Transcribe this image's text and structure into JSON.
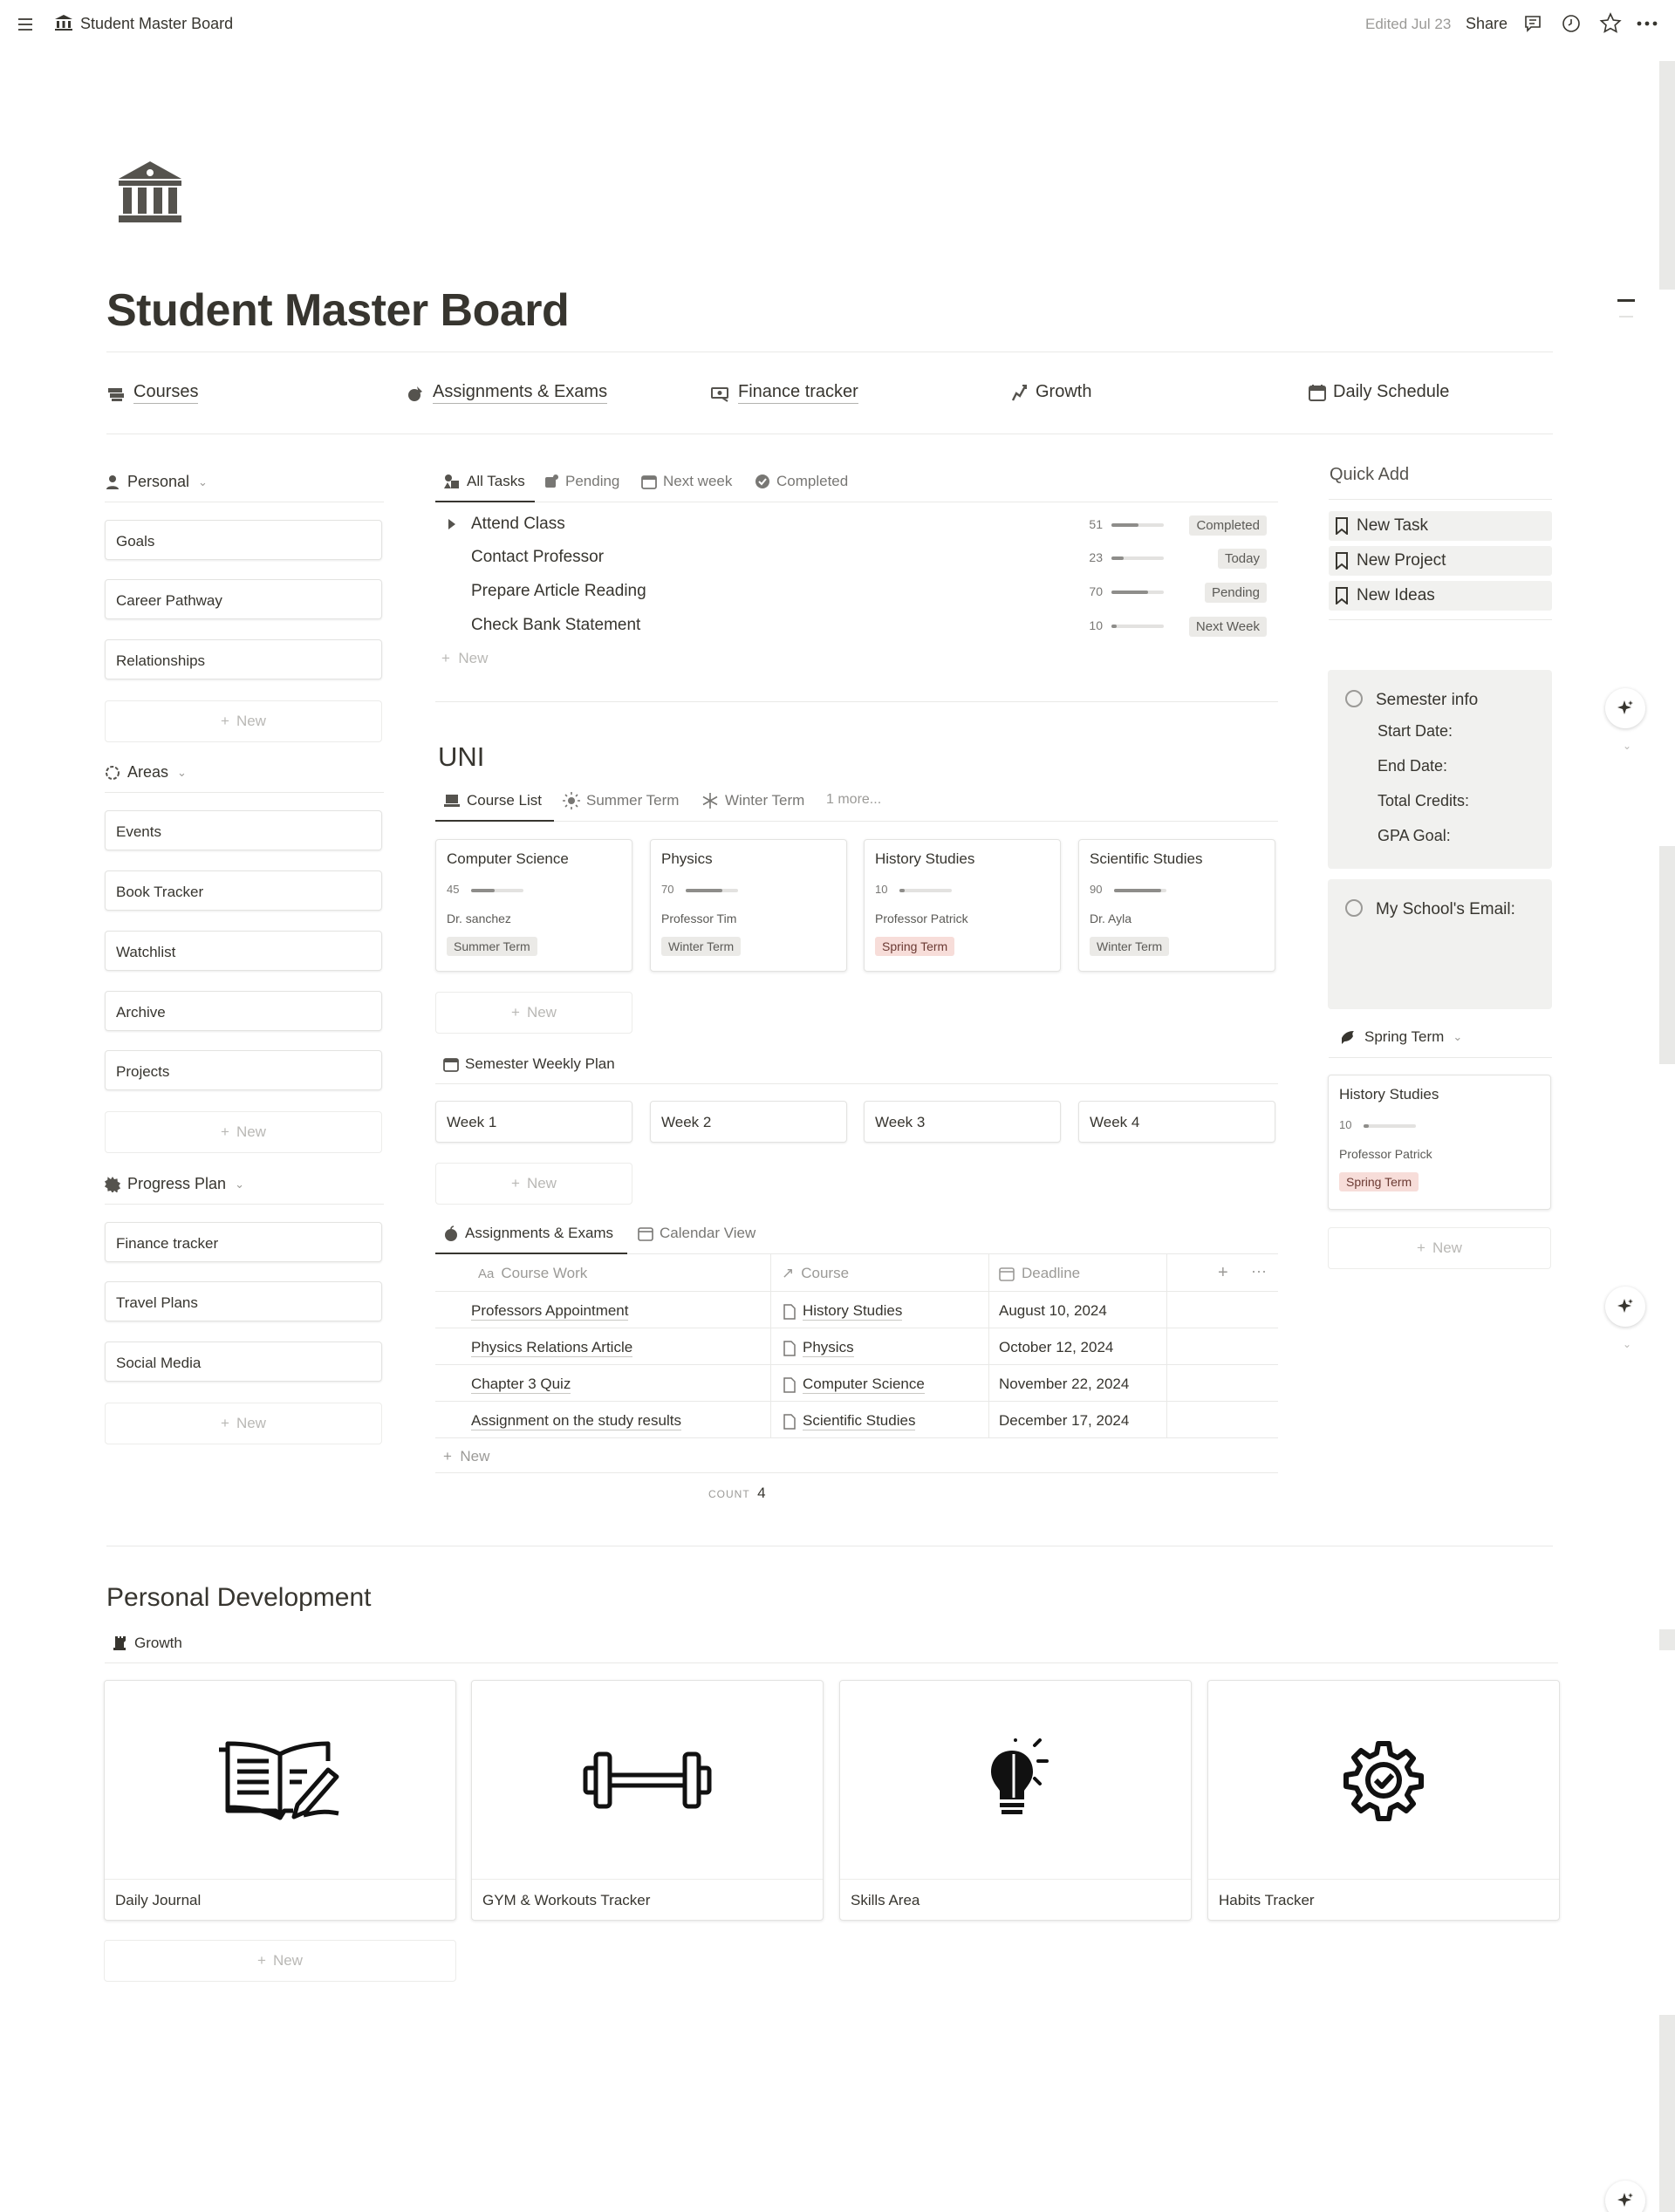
{
  "topbar": {
    "breadcrumb": "Student Master Board",
    "edited": "Edited Jul 23",
    "share": "Share"
  },
  "page": {
    "title": "Student Master Board",
    "icon": "bank-icon"
  },
  "nav": [
    {
      "label": "Courses",
      "icon": "books-icon"
    },
    {
      "label": "Assignments & Exams",
      "icon": "exam-icon"
    },
    {
      "label": "Finance tracker",
      "icon": "cash-icon"
    },
    {
      "label": "Growth",
      "icon": "growth-icon"
    },
    {
      "label": "Daily Schedule",
      "icon": "calendar-icon"
    }
  ],
  "left": {
    "personal": {
      "label": "Personal",
      "items": [
        "Goals",
        "Career Pathway",
        "Relationships"
      ]
    },
    "areas": {
      "label": "Areas",
      "items": [
        "Events",
        "Book Tracker",
        "Watchlist",
        "Archive",
        "Projects"
      ]
    },
    "progress": {
      "label": "Progress Plan",
      "items": [
        "Finance tracker",
        "Travel Plans",
        "Social Media"
      ]
    },
    "new_label": "New"
  },
  "tasks": {
    "tabs": [
      "All Tasks",
      "Pending",
      "Next week",
      "Completed"
    ],
    "rows": [
      {
        "name": "Attend Class",
        "value": 51,
        "status": "Completed"
      },
      {
        "name": "Contact Professor",
        "value": 23,
        "status": "Today"
      },
      {
        "name": "Prepare Article Reading",
        "value": 70,
        "status": "Pending"
      },
      {
        "name": "Check Bank Statement",
        "value": 10,
        "status": "Next Week"
      }
    ],
    "new_label": "New"
  },
  "uni": {
    "heading": "UNI",
    "tabs": [
      "Course List",
      "Summer Term",
      "Winter Term",
      "1 more..."
    ],
    "courses": [
      {
        "name": "Computer Science",
        "value": 45,
        "professor": "Dr. sanchez",
        "term": "Summer Term"
      },
      {
        "name": "Physics",
        "value": 70,
        "professor": "Professor Tim",
        "term": "Winter Term"
      },
      {
        "name": "History Studies",
        "value": 10,
        "professor": "Professor Patrick",
        "term": "Spring Term"
      },
      {
        "name": "Scientific Studies",
        "value": 90,
        "professor": "Dr. Ayla",
        "term": "Winter Term"
      }
    ],
    "new_label": "New"
  },
  "weekly": {
    "label": "Semester Weekly Plan",
    "weeks": [
      "Week 1",
      "Week 2",
      "Week 3",
      "Week 4"
    ],
    "new_label": "New"
  },
  "assignments": {
    "tabs": [
      "Assignments & Exams",
      "Calendar View"
    ],
    "columns": [
      "Course Work",
      "Course",
      "Deadline"
    ],
    "col_prefix": "Aa",
    "rows": [
      {
        "work": "Professors Appointment",
        "course": "History Studies",
        "deadline": "August 10, 2024"
      },
      {
        "work": "Physics Relations Article",
        "course": "Physics",
        "deadline": "October 12, 2024"
      },
      {
        "work": "Chapter 3 Quiz",
        "course": "Computer Science",
        "deadline": "November 22, 2024"
      },
      {
        "work": "Assignment on the study results",
        "course": "Scientific Studies",
        "deadline": "December 17, 2024"
      }
    ],
    "new_label": "New",
    "count_label": "COUNT",
    "count_value": "4"
  },
  "quickadd": {
    "heading": "Quick Add",
    "items": [
      "New Task",
      "New Project",
      "New Ideas"
    ]
  },
  "semester": {
    "title": "Semester info",
    "lines": [
      "Start Date:",
      "End Date:",
      "Total Credits:",
      "GPA Goal:"
    ]
  },
  "email": {
    "title": "My School's Email:"
  },
  "spring": {
    "label": "Spring Term",
    "card": {
      "name": "History Studies",
      "value": 10,
      "professor": "Professor Patrick",
      "term": "Spring Term"
    },
    "new_label": "New"
  },
  "personal_dev": {
    "heading": "Personal Development",
    "sub": "Growth",
    "cards": [
      {
        "name": "Daily Journal",
        "icon": "journal-icon"
      },
      {
        "name": "GYM & Workouts Tracker",
        "icon": "dumbbell-icon"
      },
      {
        "name": "Skills Area",
        "icon": "lightbulb-icon"
      },
      {
        "name": "Habits Tracker",
        "icon": "gear-check-icon"
      }
    ],
    "new_label": "New"
  },
  "colors": {
    "text": "#37352f",
    "muted": "#9b9a97",
    "callout_bg": "#f1f1ef",
    "chip_gray": "#ebeae7",
    "chip_red": "#f7ddd9"
  }
}
